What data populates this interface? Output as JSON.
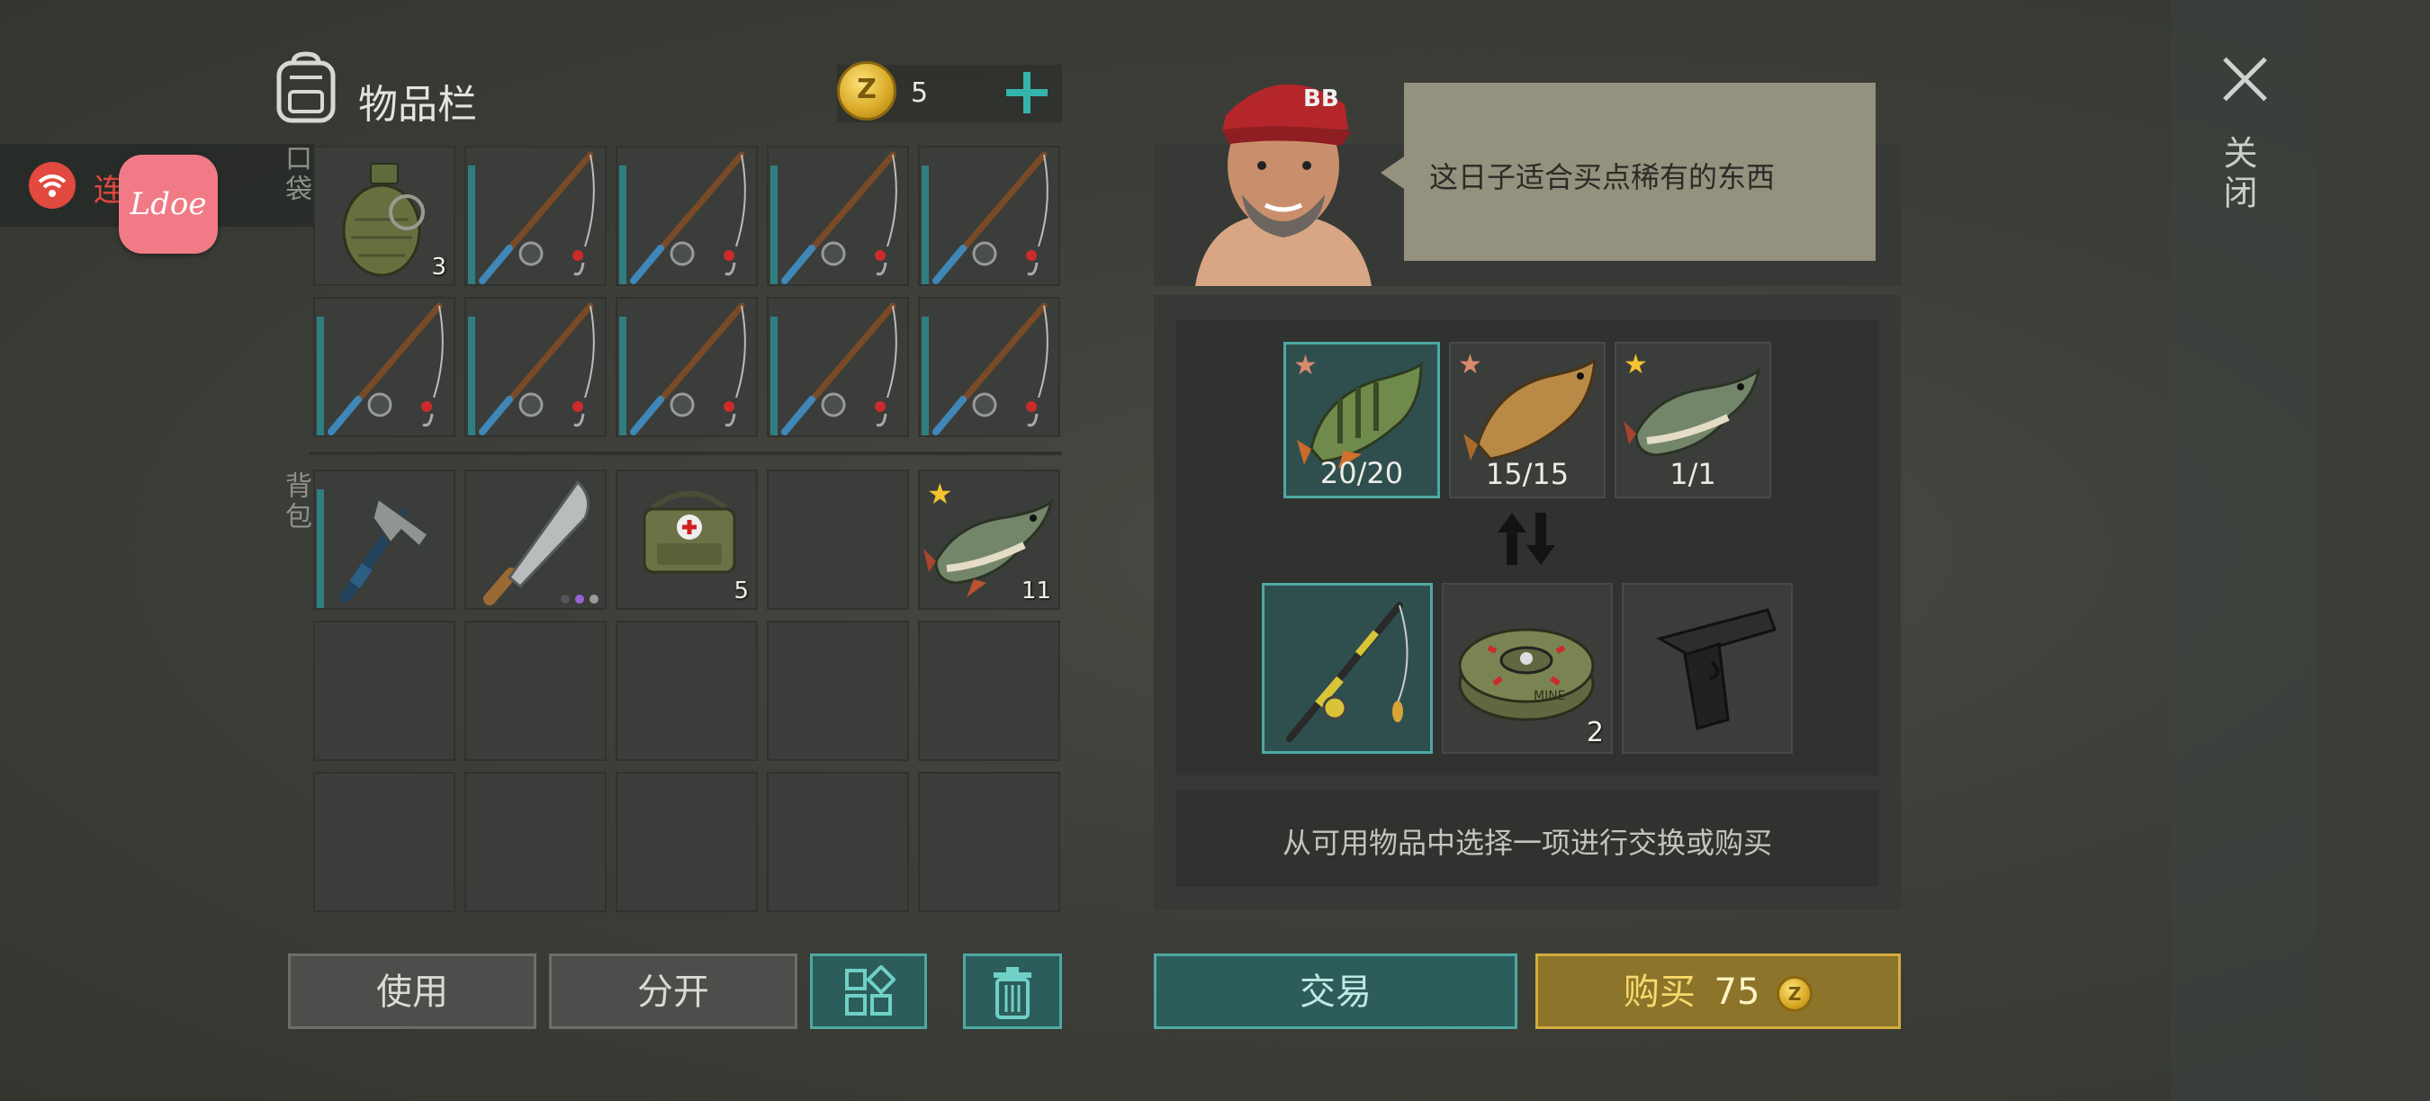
{
  "overlay": {
    "connection_text": "连",
    "app_logo_text": "Ldoe"
  },
  "inventory": {
    "title": "物品栏",
    "coins": "5",
    "pocket_label": "口袋",
    "backpack_label": "背包",
    "pocket_slots": [
      {
        "item": "grenade",
        "count": "3"
      },
      {
        "item": "fishing-rod"
      },
      {
        "item": "fishing-rod"
      },
      {
        "item": "fishing-rod"
      },
      {
        "item": "fishing-rod"
      },
      {
        "item": "fishing-rod"
      },
      {
        "item": "fishing-rod"
      },
      {
        "item": "fishing-rod"
      },
      {
        "item": "fishing-rod"
      },
      {
        "item": "fishing-rod"
      }
    ],
    "backpack_slots": [
      {
        "item": "hammer"
      },
      {
        "item": "machete"
      },
      {
        "item": "medkit-bag",
        "count": "5"
      },
      {
        "item": "empty"
      },
      {
        "item": "pike-fish",
        "count": "11"
      }
    ]
  },
  "buttons": {
    "use": "使用",
    "split": "分开",
    "trade": "交易",
    "buy": "购买",
    "buy_price": "75"
  },
  "trader": {
    "speech": "这日子适合买点稀有的东西",
    "cap_text": "BB"
  },
  "trade": {
    "requirements": [
      {
        "item": "perch-fish",
        "label": "20/20",
        "star_color": "#d98a6a"
      },
      {
        "item": "carp-fish",
        "label": "15/15",
        "star_color": "#d98a6a"
      },
      {
        "item": "pike-fish",
        "label": "1/1",
        "star_color": "#f2c230"
      }
    ],
    "offers": [
      {
        "item": "fishing-rod"
      },
      {
        "item": "landmine",
        "count": "2",
        "text": "MINE"
      },
      {
        "item": "pistol"
      }
    ],
    "hint": "从可用物品中选择一项进行交换或购买"
  },
  "close_label": "关闭",
  "colors": {
    "teal": "#4da9a2",
    "gold": "#d3ad3e",
    "alert_red": "#e2493f"
  }
}
